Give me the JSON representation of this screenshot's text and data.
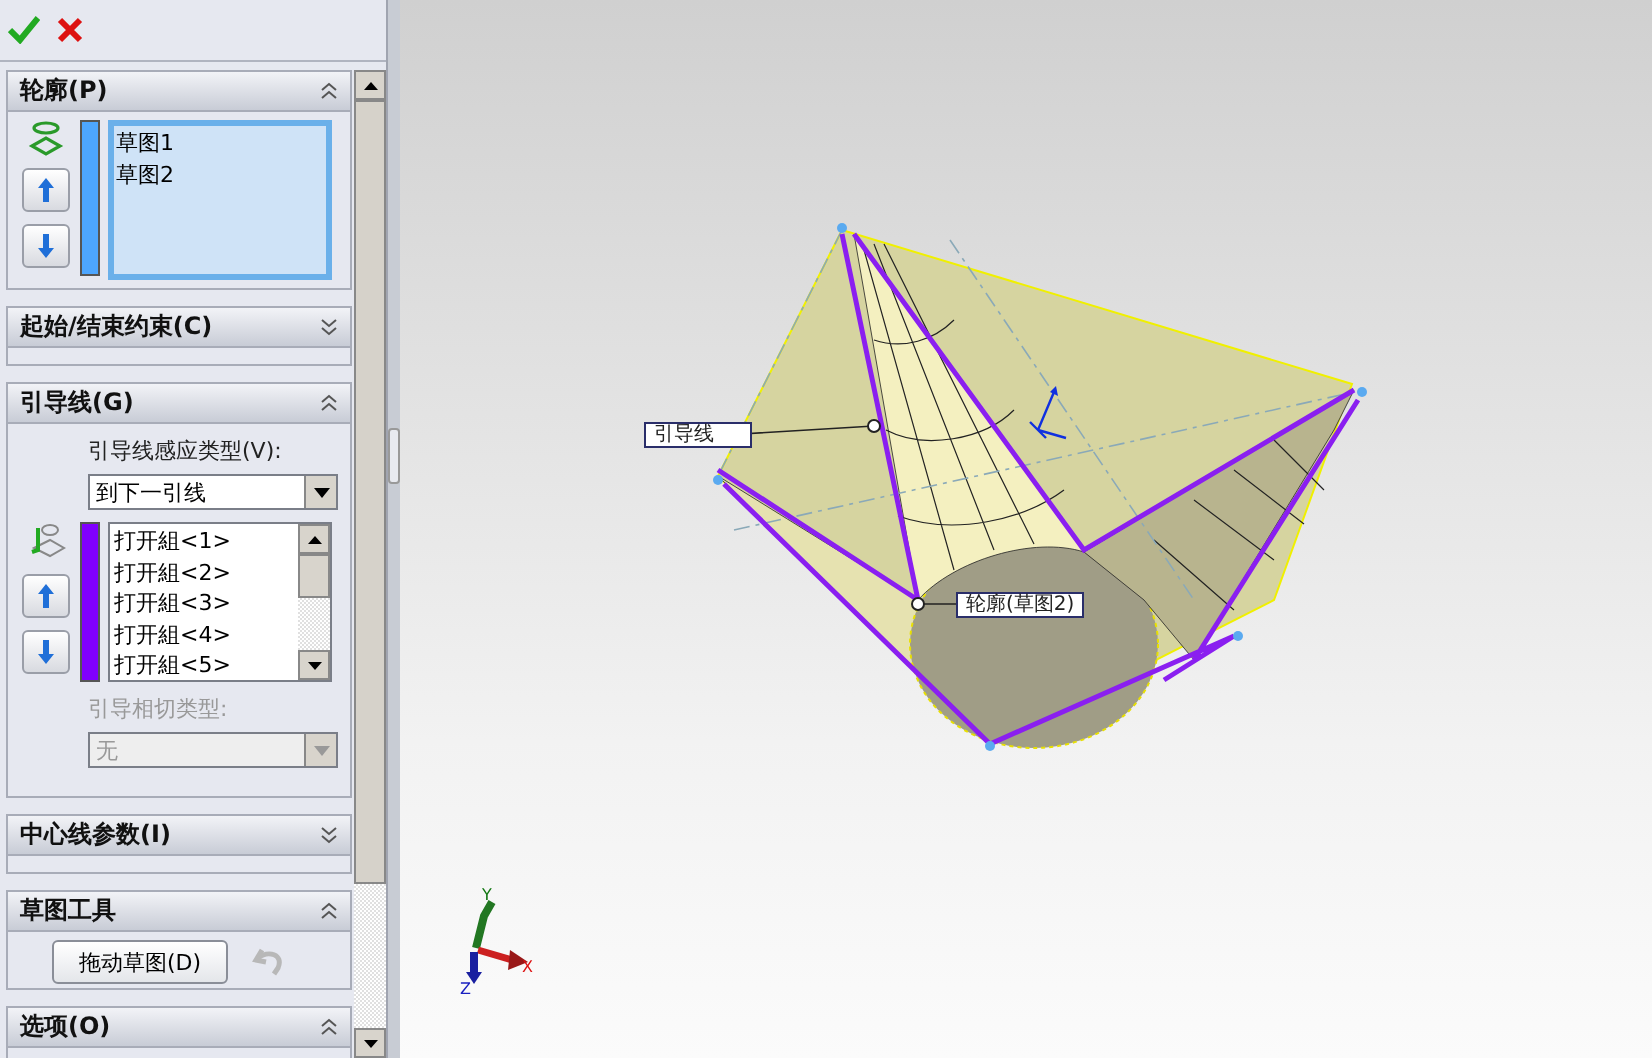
{
  "toolbar": [
    {
      "kind": "ok"
    },
    {
      "kind": "cancel"
    }
  ],
  "sections": [
    {
      "title": "轮廓(P)",
      "expanded": true,
      "kind": "profile",
      "color": "#4da6ff",
      "items": [
        {
          "label": "草图1"
        },
        {
          "label": "草图2"
        }
      ]
    },
    {
      "title": "起始/结束约束(C)",
      "expanded": false
    },
    {
      "title": "引导线(G)",
      "expanded": true,
      "kind": "guides",
      "color": "#8000ff",
      "type_label": "引导线感应类型(V):",
      "type_value": "到下一引线",
      "items": [
        {
          "label": "打开組<1>"
        },
        {
          "label": "打开組<2>"
        },
        {
          "label": "打开組<3>"
        },
        {
          "label": "打开組<4>"
        },
        {
          "label": "打开組<5>"
        }
      ],
      "tangent_label": "引导相切类型:",
      "tangent_value": "无",
      "tangent_disabled": true
    },
    {
      "title": "中心线参数(I)",
      "expanded": false
    },
    {
      "title": "草图工具",
      "expanded": true,
      "kind": "tools",
      "button": "拖动草图(D)",
      "undo_disabled": true
    },
    {
      "title": "选项(O)",
      "expanded": true
    }
  ],
  "viewport": {
    "callouts": [
      {
        "text": "引导线"
      },
      {
        "text": "轮廓(草图2)"
      }
    ],
    "triad": {
      "x": "X",
      "y": "Y",
      "z": "Z"
    }
  }
}
